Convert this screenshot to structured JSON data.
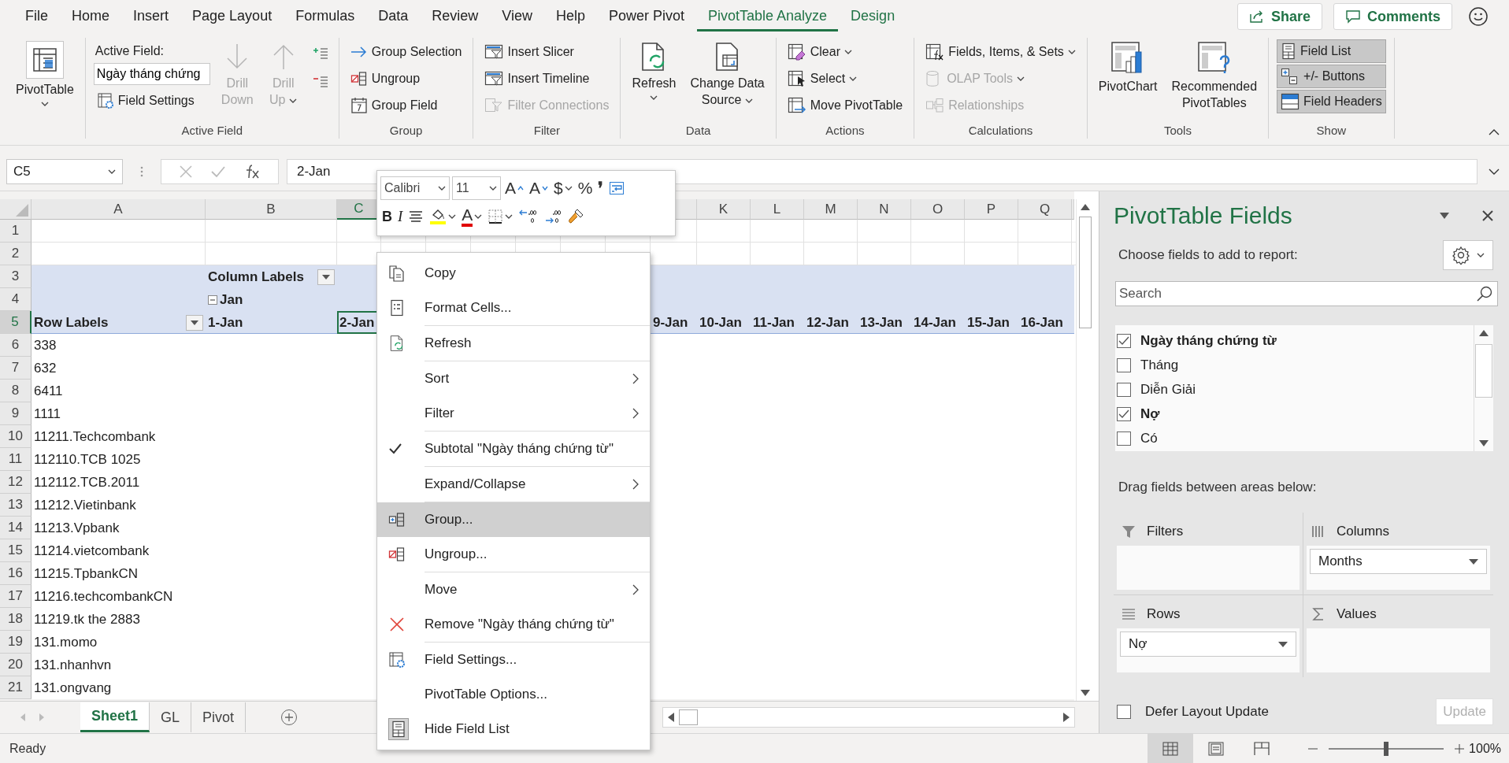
{
  "tabs": [
    {
      "label": "File",
      "selected": false,
      "contextual": false
    },
    {
      "label": "Home",
      "selected": false,
      "contextual": false
    },
    {
      "label": "Insert",
      "selected": false,
      "contextual": false
    },
    {
      "label": "Page Layout",
      "selected": false,
      "contextual": false
    },
    {
      "label": "Formulas",
      "selected": false,
      "contextual": false
    },
    {
      "label": "Data",
      "selected": false,
      "contextual": false
    },
    {
      "label": "Review",
      "selected": false,
      "contextual": false
    },
    {
      "label": "View",
      "selected": false,
      "contextual": false
    },
    {
      "label": "Help",
      "selected": false,
      "contextual": false
    },
    {
      "label": "Power Pivot",
      "selected": false,
      "contextual": false
    },
    {
      "label": "PivotTable Analyze",
      "selected": true,
      "contextual": true
    },
    {
      "label": "Design",
      "selected": false,
      "contextual": true
    }
  ],
  "share": "Share",
  "comments": "Comments",
  "ribbon": [
    {
      "columns": [
        [
          {
            "kind": "large",
            "label": "PivotTable",
            "disabled": false,
            "dropdown": true
          }
        ]
      ]
    },
    {
      "label": "Active Field",
      "columns": [
        [
          {
            "kind": "label",
            "label": "Active Field:"
          },
          {
            "kind": "field",
            "value": "Ngày tháng chứng"
          },
          {
            "kind": "small",
            "label": "Field Settings",
            "disabled": false,
            "dropdown": false
          }
        ],
        [
          {
            "kind": "large",
            "label": "Drill\nDown",
            "disabled": true,
            "dropdown": false
          }
        ],
        [
          {
            "kind": "large",
            "label": "Drill\nUp",
            "disabled": true,
            "dropdown": true
          }
        ],
        [
          {
            "kind": "icon",
            "disabled": false,
            "dropdown": false
          },
          {
            "kind": "icon",
            "disabled": false,
            "dropdown": false
          }
        ]
      ]
    },
    {
      "label": "Group",
      "columns": [
        [
          {
            "kind": "small",
            "label": "Group Selection",
            "disabled": false,
            "dropdown": false
          },
          {
            "kind": "small",
            "label": "Ungroup",
            "disabled": false,
            "dropdown": false
          },
          {
            "kind": "small",
            "label": "Group Field",
            "disabled": false,
            "dropdown": false
          }
        ]
      ]
    },
    {
      "label": "Filter",
      "columns": [
        [
          {
            "kind": "small",
            "label": "Insert Slicer",
            "disabled": false,
            "dropdown": false
          },
          {
            "kind": "small",
            "label": "Insert Timeline",
            "disabled": false,
            "dropdown": false
          },
          {
            "kind": "small",
            "label": "Filter Connections",
            "disabled": true,
            "dropdown": false
          }
        ]
      ]
    },
    {
      "label": "Data",
      "columns": [
        [
          {
            "kind": "large",
            "label": "Refresh",
            "disabled": false,
            "dropdown": true
          }
        ],
        [
          {
            "kind": "large",
            "label": "Change Data\nSource",
            "disabled": false,
            "dropdown": true
          }
        ]
      ]
    },
    {
      "label": "Actions",
      "columns": [
        [
          {
            "kind": "small",
            "label": "Clear",
            "disabled": false,
            "dropdown": true
          },
          {
            "kind": "small",
            "label": "Select",
            "disabled": false,
            "dropdown": true
          },
          {
            "kind": "small",
            "label": "Move PivotTable",
            "disabled": false,
            "dropdown": false
          }
        ]
      ]
    },
    {
      "label": "Calculations",
      "columns": [
        [
          {
            "kind": "small",
            "label": "Fields, Items, & Sets",
            "disabled": false,
            "dropdown": true
          },
          {
            "kind": "small",
            "label": "OLAP Tools",
            "disabled": true,
            "dropdown": true
          },
          {
            "kind": "small",
            "label": "Relationships",
            "disabled": true,
            "dropdown": false
          }
        ]
      ]
    },
    {
      "label": "Tools",
      "columns": [
        [
          {
            "kind": "large",
            "label": "PivotChart",
            "disabled": false,
            "dropdown": false
          }
        ],
        [
          {
            "kind": "large",
            "label": "Recommended\nPivotTables",
            "disabled": false,
            "dropdown": false
          }
        ]
      ]
    },
    {
      "label": "Show",
      "columns": [
        [
          {
            "kind": "small",
            "label": "Field List",
            "disabled": false,
            "dropdown": false,
            "on": true
          },
          {
            "kind": "small",
            "label": "+/- Buttons",
            "disabled": false,
            "dropdown": false,
            "on": true
          },
          {
            "kind": "small",
            "label": "Field Headers",
            "disabled": false,
            "dropdown": false,
            "on": true
          }
        ]
      ]
    }
  ],
  "formula_bar": {
    "name_box": "C5",
    "formula": "2-Jan"
  },
  "sheet": {
    "columns": [
      {
        "letter": "A",
        "selected": false
      },
      {
        "letter": "B",
        "selected": false
      },
      {
        "letter": "C",
        "selected": true
      },
      {
        "letter": "K",
        "selected": false
      },
      {
        "letter": "L",
        "selected": false
      },
      {
        "letter": "M",
        "selected": false
      },
      {
        "letter": "N",
        "selected": false
      },
      {
        "letter": "O",
        "selected": false
      },
      {
        "letter": "P",
        "selected": false
      },
      {
        "letter": "Q",
        "selected": false
      }
    ],
    "rows": [
      {
        "number": "1",
        "kind": "blank",
        "selected": false
      },
      {
        "number": "2",
        "kind": "blank",
        "selected": false
      },
      {
        "number": "3",
        "kind": "pivot-header",
        "selected": false,
        "cells": [
          null,
          {
            "text": "Column Labels",
            "kind": "filter"
          }
        ]
      },
      {
        "number": "4",
        "kind": "pivot-header",
        "selected": false,
        "cells": [
          null,
          {
            "text": "Jan",
            "kind": "collapse"
          }
        ]
      },
      {
        "number": "5",
        "kind": "pivot-header",
        "selected": true,
        "cells": [
          {
            "text": "Row Labels",
            "kind": "filter"
          },
          "1-Jan",
          "2-Jan",
          null,
          null,
          null,
          null,
          null,
          null,
          "9-Jan",
          "10-Jan",
          "11-Jan",
          "12-Jan",
          "13-Jan",
          "14-Jan",
          "15-Jan",
          "16-Jan"
        ]
      },
      {
        "number": "6",
        "kind": "data",
        "selected": false,
        "cells": [
          "338"
        ]
      },
      {
        "number": "7",
        "kind": "data",
        "selected": false,
        "cells": [
          "632"
        ]
      },
      {
        "number": "8",
        "kind": "data",
        "selected": false,
        "cells": [
          "6411"
        ]
      },
      {
        "number": "9",
        "kind": "data",
        "selected": false,
        "cells": [
          "1111"
        ]
      },
      {
        "number": "10",
        "kind": "data",
        "selected": false,
        "cells": [
          "11211.Techcombank"
        ]
      },
      {
        "number": "11",
        "kind": "data",
        "selected": false,
        "cells": [
          "112110.TCB 1025"
        ]
      },
      {
        "number": "12",
        "kind": "data",
        "selected": false,
        "cells": [
          "112112.TCB.2011"
        ]
      },
      {
        "number": "13",
        "kind": "data",
        "selected": false,
        "cells": [
          "11212.Vietinbank"
        ]
      },
      {
        "number": "14",
        "kind": "data",
        "selected": false,
        "cells": [
          "11213.Vpbank"
        ]
      },
      {
        "number": "15",
        "kind": "data",
        "selected": false,
        "cells": [
          "11214.vietcombank"
        ]
      },
      {
        "number": "16",
        "kind": "data",
        "selected": false,
        "cells": [
          "11215.TpbankCN"
        ]
      },
      {
        "number": "17",
        "kind": "data",
        "selected": false,
        "cells": [
          "11216.techcombankCN"
        ]
      },
      {
        "number": "18",
        "kind": "data",
        "selected": false,
        "cells": [
          "11219.tk the 2883"
        ]
      },
      {
        "number": "19",
        "kind": "data",
        "selected": false,
        "cells": [
          "131.momo"
        ]
      },
      {
        "number": "20",
        "kind": "data",
        "selected": false,
        "cells": [
          "131.nhanhvn"
        ]
      },
      {
        "number": "21",
        "kind": "data",
        "selected": false,
        "cells": [
          "131.ongvang"
        ]
      }
    ]
  },
  "sheet_tabs": [
    {
      "label": "Sheet1",
      "selected": true
    },
    {
      "label": "GL",
      "selected": false
    },
    {
      "label": "Pivot",
      "selected": false
    }
  ],
  "mini_toolbar": {
    "font": "Calibri",
    "size": "11",
    "row1": [
      {
        "kind": "grow",
        "label": "A",
        "dropdown": false
      },
      {
        "kind": "shrink",
        "label": "A",
        "dropdown": false
      },
      {
        "kind": "currency",
        "label": "$",
        "dropdown": true
      },
      {
        "kind": "percent",
        "label": "%",
        "dropdown": false
      },
      {
        "kind": "comma",
        "label": "❜",
        "dropdown": false
      },
      {
        "kind": "wrap",
        "dropdown": false
      }
    ],
    "row2": [
      {
        "kind": "bold",
        "label": "B",
        "dropdown": false
      },
      {
        "kind": "italic",
        "label": "I",
        "dropdown": false
      },
      {
        "kind": "align",
        "dropdown": false
      },
      {
        "kind": "fill",
        "dropdown": true
      },
      {
        "kind": "fontcolor",
        "label": "A",
        "dropdown": true
      },
      {
        "kind": "borders",
        "dropdown": true
      },
      {
        "kind": "decrease",
        "dropdown": false
      },
      {
        "kind": "increase",
        "dropdown": false
      },
      {
        "kind": "painter",
        "dropdown": false
      }
    ]
  },
  "context_menu": [
    {
      "label": "Copy",
      "divider_above": false,
      "submenu": false,
      "checked": false,
      "selected": false
    },
    {
      "label": "Format Cells...",
      "divider_above": false,
      "submenu": false,
      "checked": false,
      "selected": false
    },
    {
      "label": "Refresh",
      "divider_above": true,
      "submenu": false,
      "checked": false,
      "selected": false
    },
    {
      "label": "Sort",
      "divider_above": true,
      "submenu": true,
      "checked": false,
      "selected": false
    },
    {
      "label": "Filter",
      "divider_above": false,
      "submenu": true,
      "checked": false,
      "selected": false
    },
    {
      "label": "Subtotal \"Ngày tháng chứng từ\"",
      "divider_above": true,
      "submenu": false,
      "checked": true,
      "selected": false
    },
    {
      "label": "Expand/Collapse",
      "divider_above": true,
      "submenu": true,
      "checked": false,
      "selected": false
    },
    {
      "label": "Group...",
      "divider_above": true,
      "submenu": false,
      "checked": false,
      "selected": true
    },
    {
      "label": "Ungroup...",
      "divider_above": false,
      "submenu": false,
      "checked": false,
      "selected": false
    },
    {
      "label": "Move",
      "divider_above": true,
      "submenu": true,
      "checked": false,
      "selected": false
    },
    {
      "label": "Remove \"Ngày tháng chứng từ\"",
      "divider_above": false,
      "submenu": false,
      "checked": false,
      "selected": false
    },
    {
      "label": "Field Settings...",
      "divider_above": true,
      "submenu": false,
      "checked": false,
      "selected": false
    },
    {
      "label": "PivotTable Options...",
      "divider_above": false,
      "submenu": false,
      "checked": false,
      "selected": false
    },
    {
      "label": "Hide Field List",
      "divider_above": false,
      "submenu": false,
      "checked": false,
      "selected": false
    }
  ],
  "pane": {
    "title": "PivotTable Fields",
    "choose": "Choose fields to add to report:",
    "search_placeholder": "Search",
    "fields": [
      {
        "label": "Ngày tháng chứng từ",
        "checked": true
      },
      {
        "label": "Tháng",
        "checked": false
      },
      {
        "label": "Diễn Giải",
        "checked": false
      },
      {
        "label": "Nợ",
        "checked": true
      },
      {
        "label": "Có",
        "checked": false
      }
    ],
    "drag_hint": "Drag fields between areas below:",
    "areas": [
      {
        "title": "Filters"
      },
      {
        "title": "Columns",
        "items": [
          "Months"
        ]
      },
      {
        "title": "Rows",
        "items": [
          "Nợ"
        ]
      },
      {
        "title": "Values"
      }
    ],
    "defer": {
      "label": "Defer Layout Update",
      "checked": false
    },
    "update": {
      "label": "Update",
      "disabled": true
    }
  },
  "status": {
    "text": "Ready",
    "views": [
      {
        "selected": true
      },
      {
        "selected": false
      },
      {
        "selected": false
      }
    ],
    "zoom": {
      "level": 0.5,
      "reading": "100%"
    }
  }
}
